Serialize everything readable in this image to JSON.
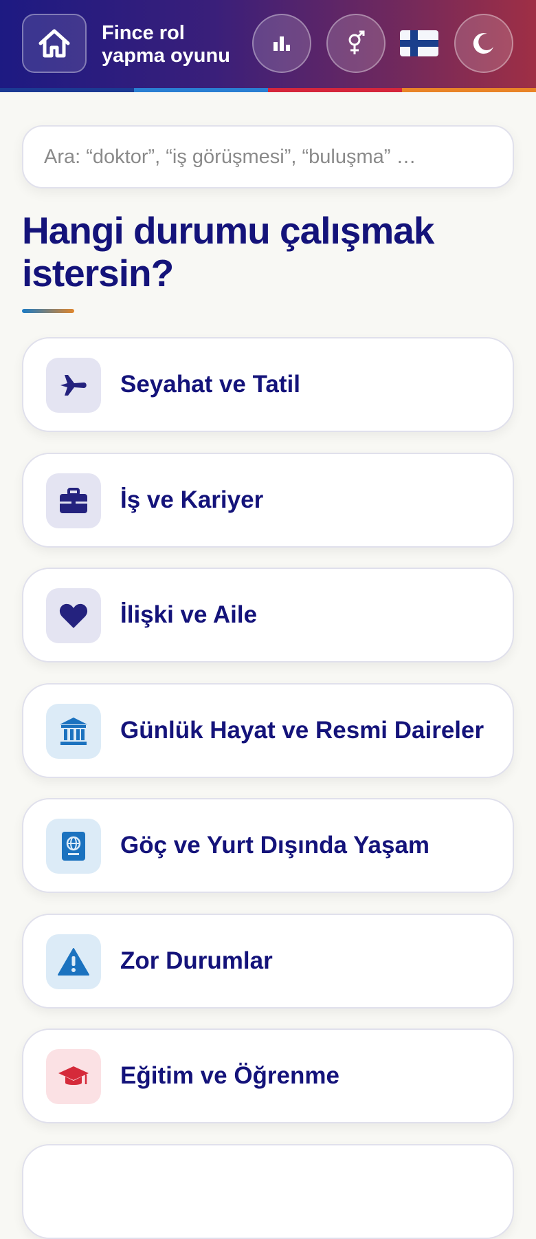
{
  "header": {
    "title_line1": "Fince rol",
    "title_line2": "yapma oyunu",
    "icons": [
      "home-icon",
      "bar-chart-icon",
      "gender-icon",
      "finland-flag-icon",
      "moon-icon"
    ]
  },
  "stripe_colors": [
    "#1b3a93",
    "#2a7fd2",
    "#d5263c",
    "#e98427"
  ],
  "search": {
    "placeholder": "Ara: “doktor”, “iş görüşmesi”, “buluşma” …",
    "value": ""
  },
  "heading": "Hangi durumu çalışmak istersin?",
  "categories": [
    {
      "label": "Seyahat ve Tatil",
      "icon": "plane-icon",
      "icon_bg": "#e4e4f2",
      "icon_color": "#24227e"
    },
    {
      "label": "İş ve Kariyer",
      "icon": "briefcase-icon",
      "icon_bg": "#e4e4f2",
      "icon_color": "#24227e"
    },
    {
      "label": "İlişki ve Aile",
      "icon": "heart-icon",
      "icon_bg": "#e4e4f2",
      "icon_color": "#24227e"
    },
    {
      "label": "Günlük Hayat ve Resmi Daireler",
      "icon": "building-icon",
      "icon_bg": "#dcebf7",
      "icon_color": "#1b72bf"
    },
    {
      "label": "Göç ve Yurt Dışında Yaşam",
      "icon": "passport-icon",
      "icon_bg": "#dcebf7",
      "icon_color": "#1b72bf"
    },
    {
      "label": "Zor Durumlar",
      "icon": "warning-icon",
      "icon_bg": "#dcebf7",
      "icon_color": "#1b72bf"
    },
    {
      "label": "Eğitim ve Öğrenme",
      "icon": "graduation-cap-icon",
      "icon_bg": "#fbe1e4",
      "icon_color": "#d52a3a"
    },
    {
      "label": "",
      "icon": "",
      "icon_bg": "#ffffff",
      "icon_color": "#ffffff"
    }
  ]
}
